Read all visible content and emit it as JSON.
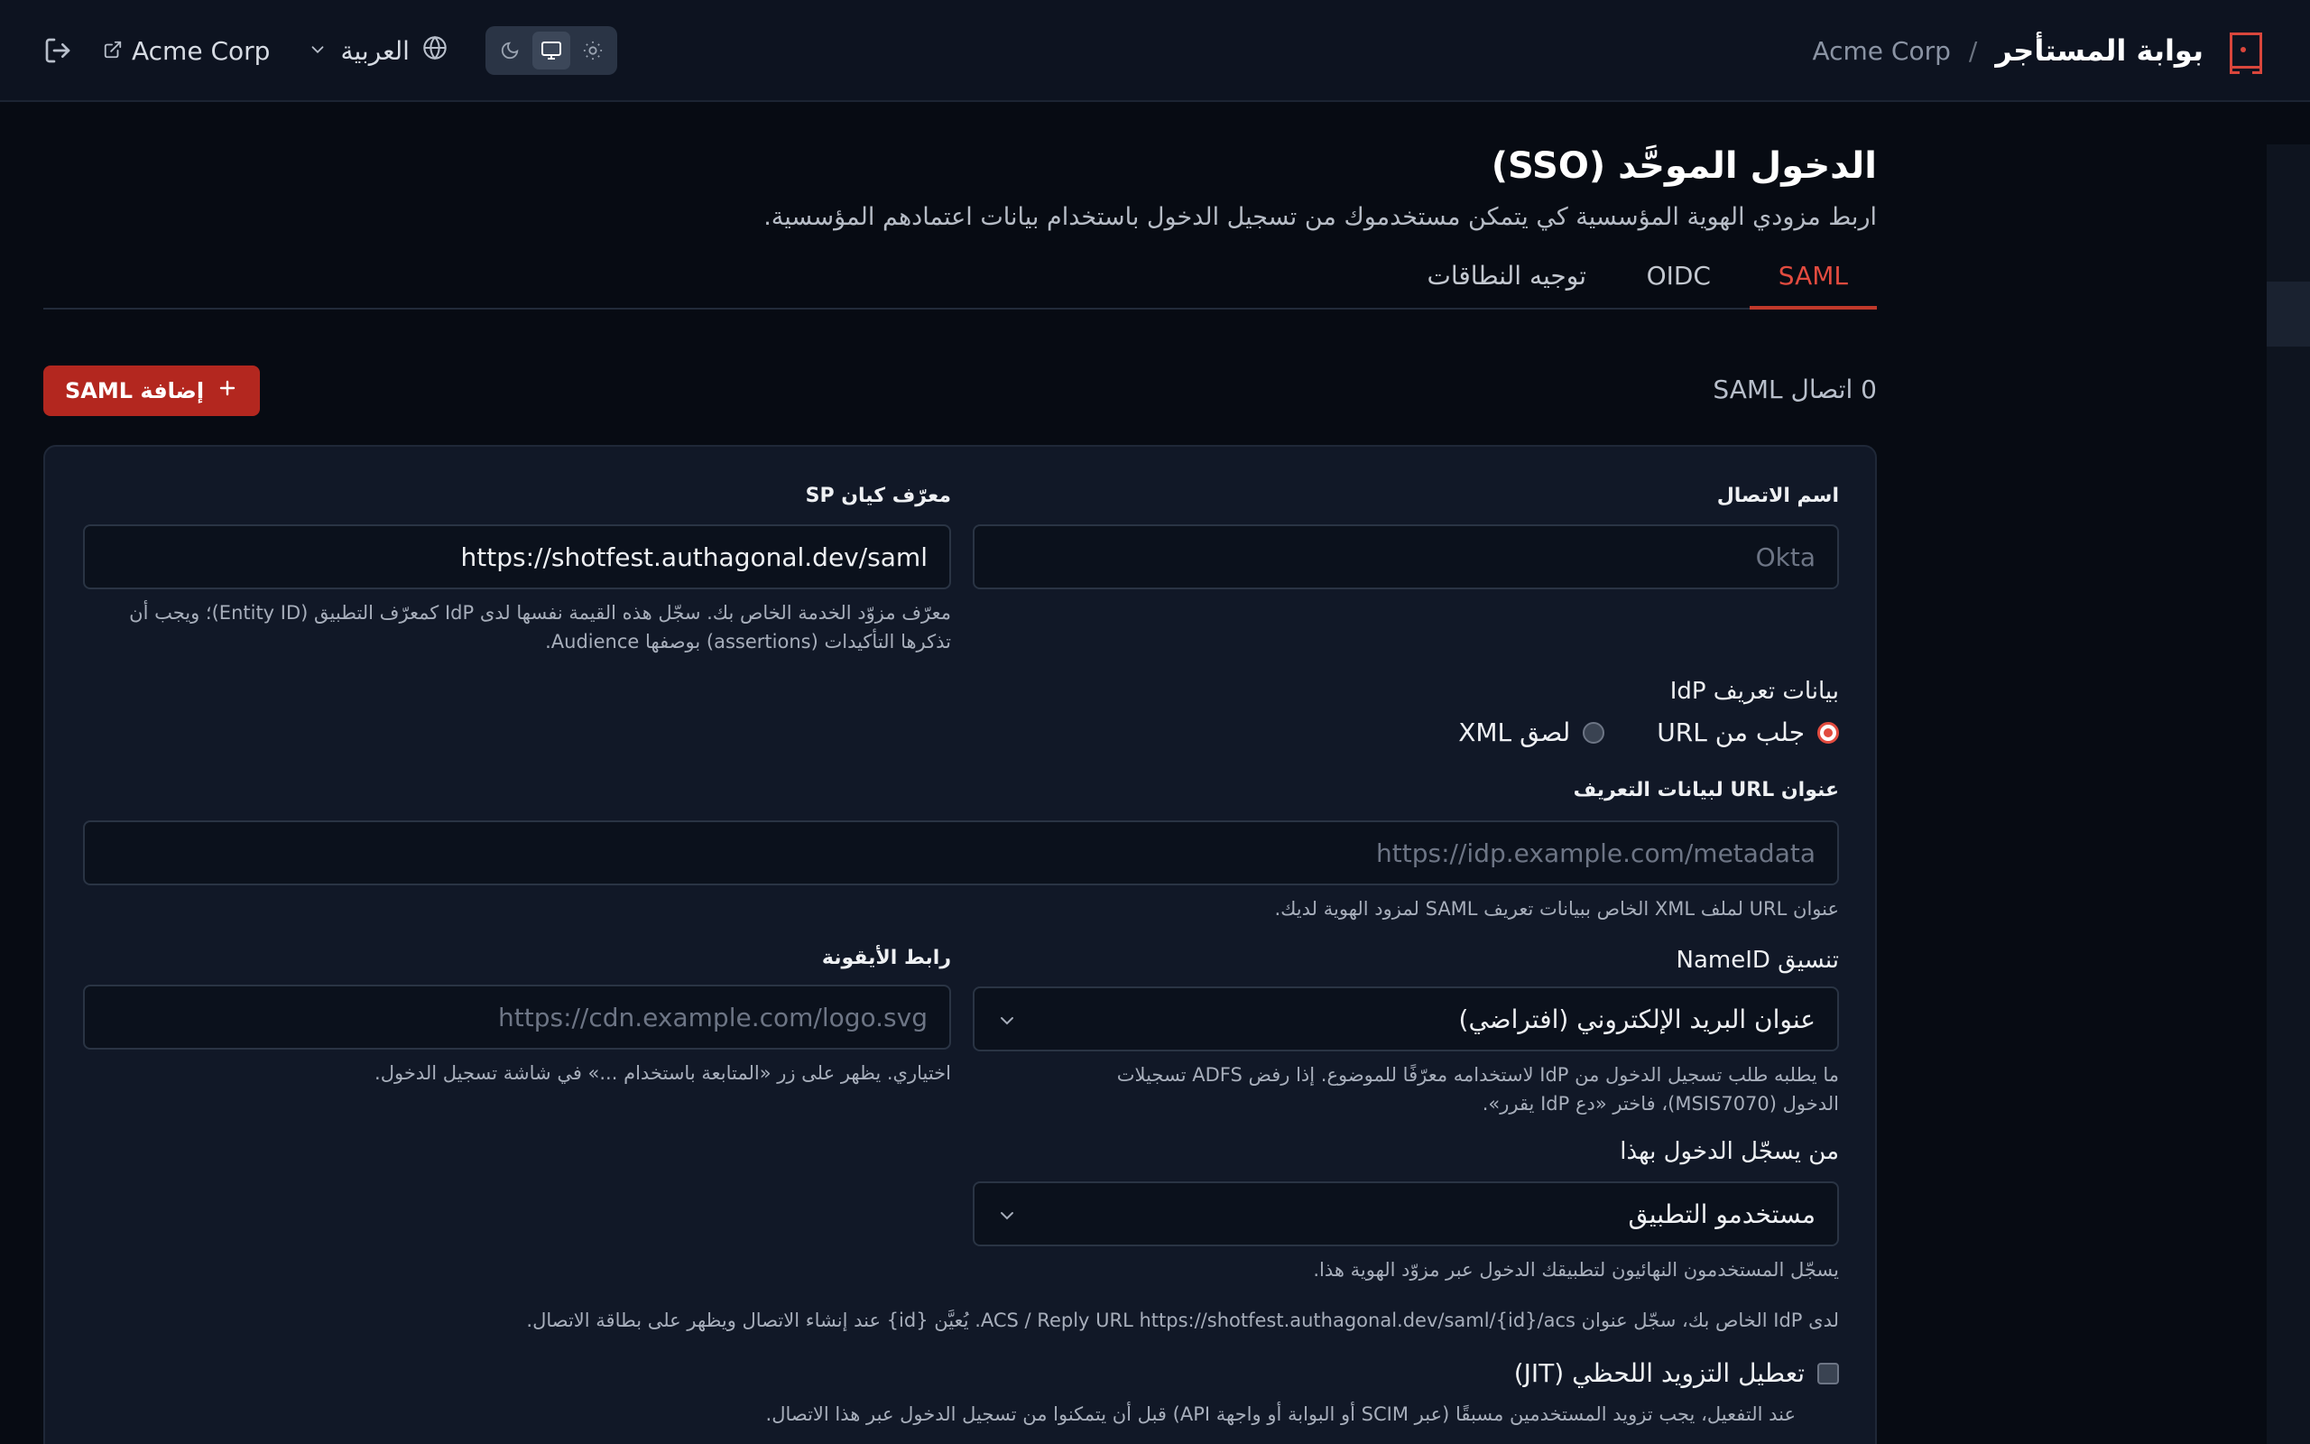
{
  "header": {
    "title": "بوابة المستأجر",
    "separator": "/",
    "tenant": "Acme Corp",
    "org_link": "Acme Corp",
    "language": "العربية"
  },
  "page": {
    "title": "الدخول الموحَّد (SSO)",
    "subtitle": "اربط مزودي الهوية المؤسسية كي يتمكن مستخدموك من تسجيل الدخول باستخدام بيانات اعتمادهم المؤسسية."
  },
  "tabs": [
    {
      "label": "SAML",
      "active": true
    },
    {
      "label": "OIDC",
      "active": false
    },
    {
      "label": "توجيه النطاقات",
      "active": false
    }
  ],
  "list": {
    "count_label": "0 اتصال SAML",
    "add_button": "إضافة SAML"
  },
  "form": {
    "connection_name": {
      "label": "اسم الاتصال",
      "placeholder": "Okta",
      "value": ""
    },
    "sp_entity_id": {
      "label": "معرّف كيان SP",
      "value": "https://shotfest.authagonal.dev/saml",
      "help_line1": "معرّف مزوّد الخدمة الخاص بك. سجّل هذه القيمة نفسها لدى IdP كمعرّف التطبيق (Entity ID)؛ ويجب أن",
      "help_line2": "تذكرها التأكيدات (assertions) بوصفها Audience."
    },
    "metadata": {
      "label": "بيانات تعريف IdP",
      "option_url": "جلب من URL",
      "option_xml": "لصق XML",
      "selected": "url"
    },
    "metadata_url": {
      "label": "عنوان URL لبيانات التعريف",
      "placeholder": "https://idp.example.com/metadata",
      "help": "عنوان URL لملف XML الخاص ببيانات تعريف SAML لمزود الهوية لديك."
    },
    "nameid": {
      "label": "تنسيق NameID",
      "value": "عنوان البريد الإلكتروني (افتراضي)",
      "help_line1": "ما يطلبه طلب تسجيل الدخول من IdP لاستخدامه معرّفًا للموضوع. إذا رفض ADFS تسجيلات",
      "help_line2": "الدخول (MSIS7070)، فاختر «دع IdP يقرر»."
    },
    "icon_url": {
      "label": "رابط الأيقونة",
      "placeholder": "https://cdn.example.com/logo.svg",
      "help": "اختياري. يظهر على زر «المتابعة باستخدام ...» في شاشة تسجيل الدخول."
    },
    "audience": {
      "label": "من يسجّل الدخول بهذا",
      "value": "مستخدمو التطبيق",
      "help": "يسجّل المستخدمون النهائيون لتطبيقك الدخول عبر مزوّد الهوية هذا."
    },
    "acs_note": "لدى IdP الخاص بك، سجّل عنوان ACS / Reply URL https://shotfest.authagonal.dev/saml/{id}/acs. يُعيَّن {id} عند إنشاء الاتصال ويظهر على بطاقة الاتصال.",
    "jit": {
      "label": "تعطيل التزويد اللحظي (JIT)",
      "checked": false,
      "help": "عند التفعيل، يجب تزويد المستخدمين مسبقًا (عبر SCIM أو البوابة أو واجهة API) قبل أن يتمكنوا من تسجيل الدخول عبر هذا الاتصال."
    }
  },
  "colors": {
    "accent": "#c0392b",
    "background": "#070b13",
    "card": "#111827"
  },
  "icons": [
    "logout-icon",
    "external-link-icon",
    "chevron-down-icon",
    "globe-icon",
    "moon-icon",
    "monitor-icon",
    "sun-icon",
    "plus-icon",
    "brand-logo-icon"
  ],
  "theme": {
    "options": [
      "dark",
      "system",
      "light"
    ],
    "selected": "system"
  }
}
